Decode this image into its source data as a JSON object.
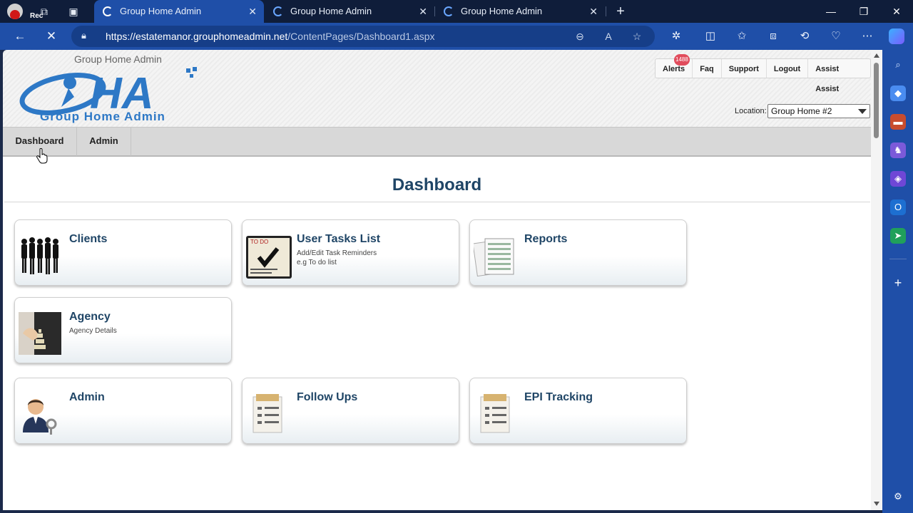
{
  "browser": {
    "rec_label": "Rec",
    "tabs": [
      {
        "title": "Group Home Admin",
        "active": true
      },
      {
        "title": "Group Home Admin",
        "active": false
      },
      {
        "title": "Group Home Admin",
        "active": false
      }
    ],
    "url_host": "https://estatemanor.grouphomeadmin.net",
    "url_path": "/ContentPages/Dashboard1.aspx"
  },
  "header": {
    "site_name": "Group Home Admin",
    "logo_text": "HA",
    "logo_subtitle": "Group Home Admin",
    "top_menu": [
      {
        "label": "Alerts",
        "badge": "1488"
      },
      {
        "label": "Faq"
      },
      {
        "label": "Support"
      },
      {
        "label": "Logout"
      },
      {
        "label": "Assist Assist"
      }
    ],
    "location_label": "Location:",
    "location_value": "Group Home #2"
  },
  "nav": {
    "items": [
      {
        "label": "Dashboard"
      },
      {
        "label": "Admin"
      }
    ]
  },
  "main": {
    "title": "Dashboard",
    "cards": [
      {
        "title": "Clients",
        "subtitle": ""
      },
      {
        "title": "User Tasks List",
        "subtitle": "Add/Edit Task Reminders",
        "subtitle2": "e.g To do list",
        "img_text": "TO DO"
      },
      {
        "title": "Reports",
        "subtitle": ""
      },
      {
        "title": "Agency",
        "subtitle": "Agency Details"
      },
      {
        "title": "Admin",
        "subtitle": ""
      },
      {
        "title": "Follow Ups",
        "subtitle": ""
      },
      {
        "title": "EPI Tracking",
        "subtitle": ""
      }
    ]
  },
  "colors": {
    "browser_frame": "#1f4fa8",
    "heading": "#1f4566",
    "alert_badge": "#e14c5c"
  }
}
